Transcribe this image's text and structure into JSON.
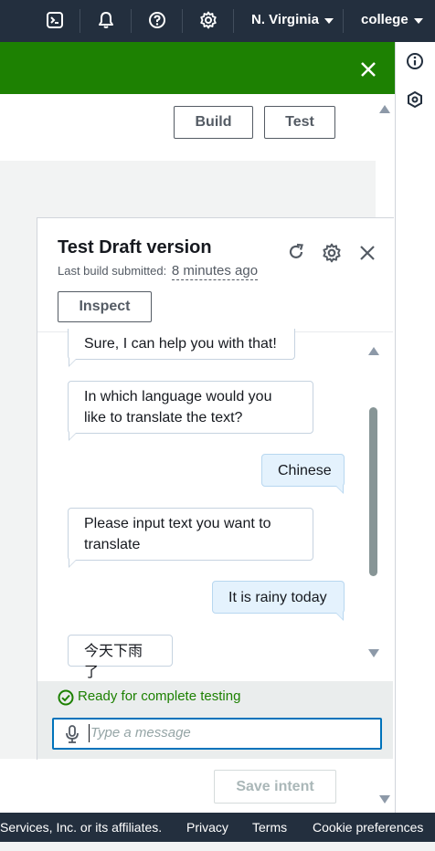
{
  "topnav": {
    "region_label": "N. Virginia",
    "account_label": "college",
    "icons": [
      "cloudshell-icon",
      "bell-icon",
      "help-icon",
      "settings-icon"
    ]
  },
  "header": {
    "build_label": "Build",
    "test_label": "Test"
  },
  "test_panel": {
    "title": "Test Draft version",
    "last_build_prefix": "Last build submitted:",
    "last_build_time": "8 minutes ago",
    "inspect_label": "Inspect",
    "messages": [
      {
        "from": "bot",
        "text": "Sure, I can help you with that!"
      },
      {
        "from": "bot",
        "text": "In which language would you like to translate the text?"
      },
      {
        "from": "user",
        "text": "Chinese"
      },
      {
        "from": "bot",
        "text": "Please input text you want to translate"
      },
      {
        "from": "user",
        "text": "It is rainy today"
      },
      {
        "from": "bot",
        "text": "今天下雨了"
      }
    ],
    "status_text": "Ready for complete testing",
    "input_placeholder": "Type a message"
  },
  "save_intent_label": "Save intent",
  "footer": {
    "copyright": "Services, Inc. or its affiliates.",
    "privacy": "Privacy",
    "terms": "Terms",
    "cookies": "Cookie preferences"
  },
  "colors": {
    "nav_bg": "#232f3e",
    "banner_green": "#1d8102",
    "accent_blue": "#0073bb",
    "user_bubble": "#e4f2fd"
  }
}
